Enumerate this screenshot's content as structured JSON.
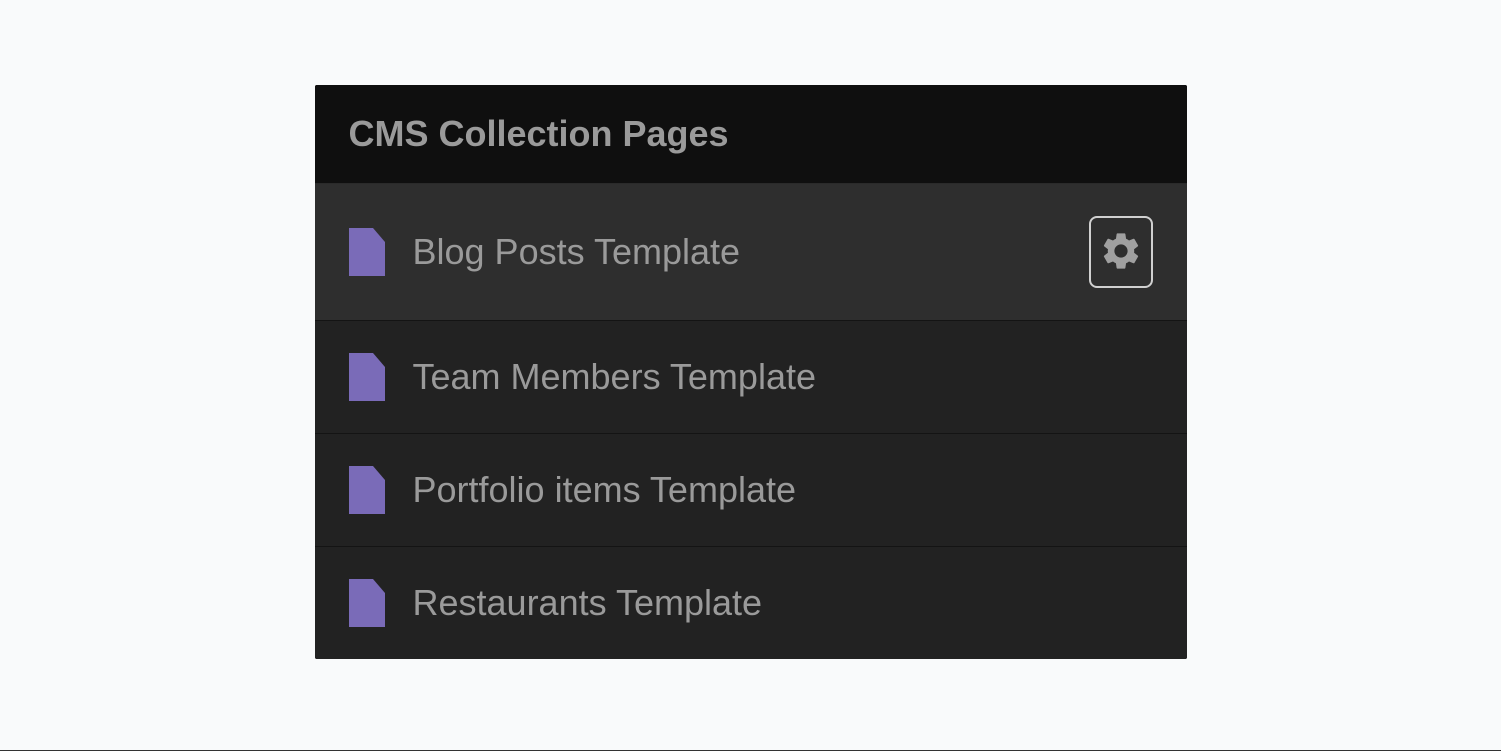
{
  "panel": {
    "title": "CMS Collection Pages",
    "items": [
      {
        "label": "Blog Posts Template",
        "active": true,
        "showGear": true
      },
      {
        "label": "Team Members Template",
        "active": false,
        "showGear": false
      },
      {
        "label": "Portfolio items Template",
        "active": false,
        "showGear": false
      },
      {
        "label": "Restaurants Template",
        "active": false,
        "showGear": false
      }
    ],
    "iconColor": "#7a6bb8"
  }
}
